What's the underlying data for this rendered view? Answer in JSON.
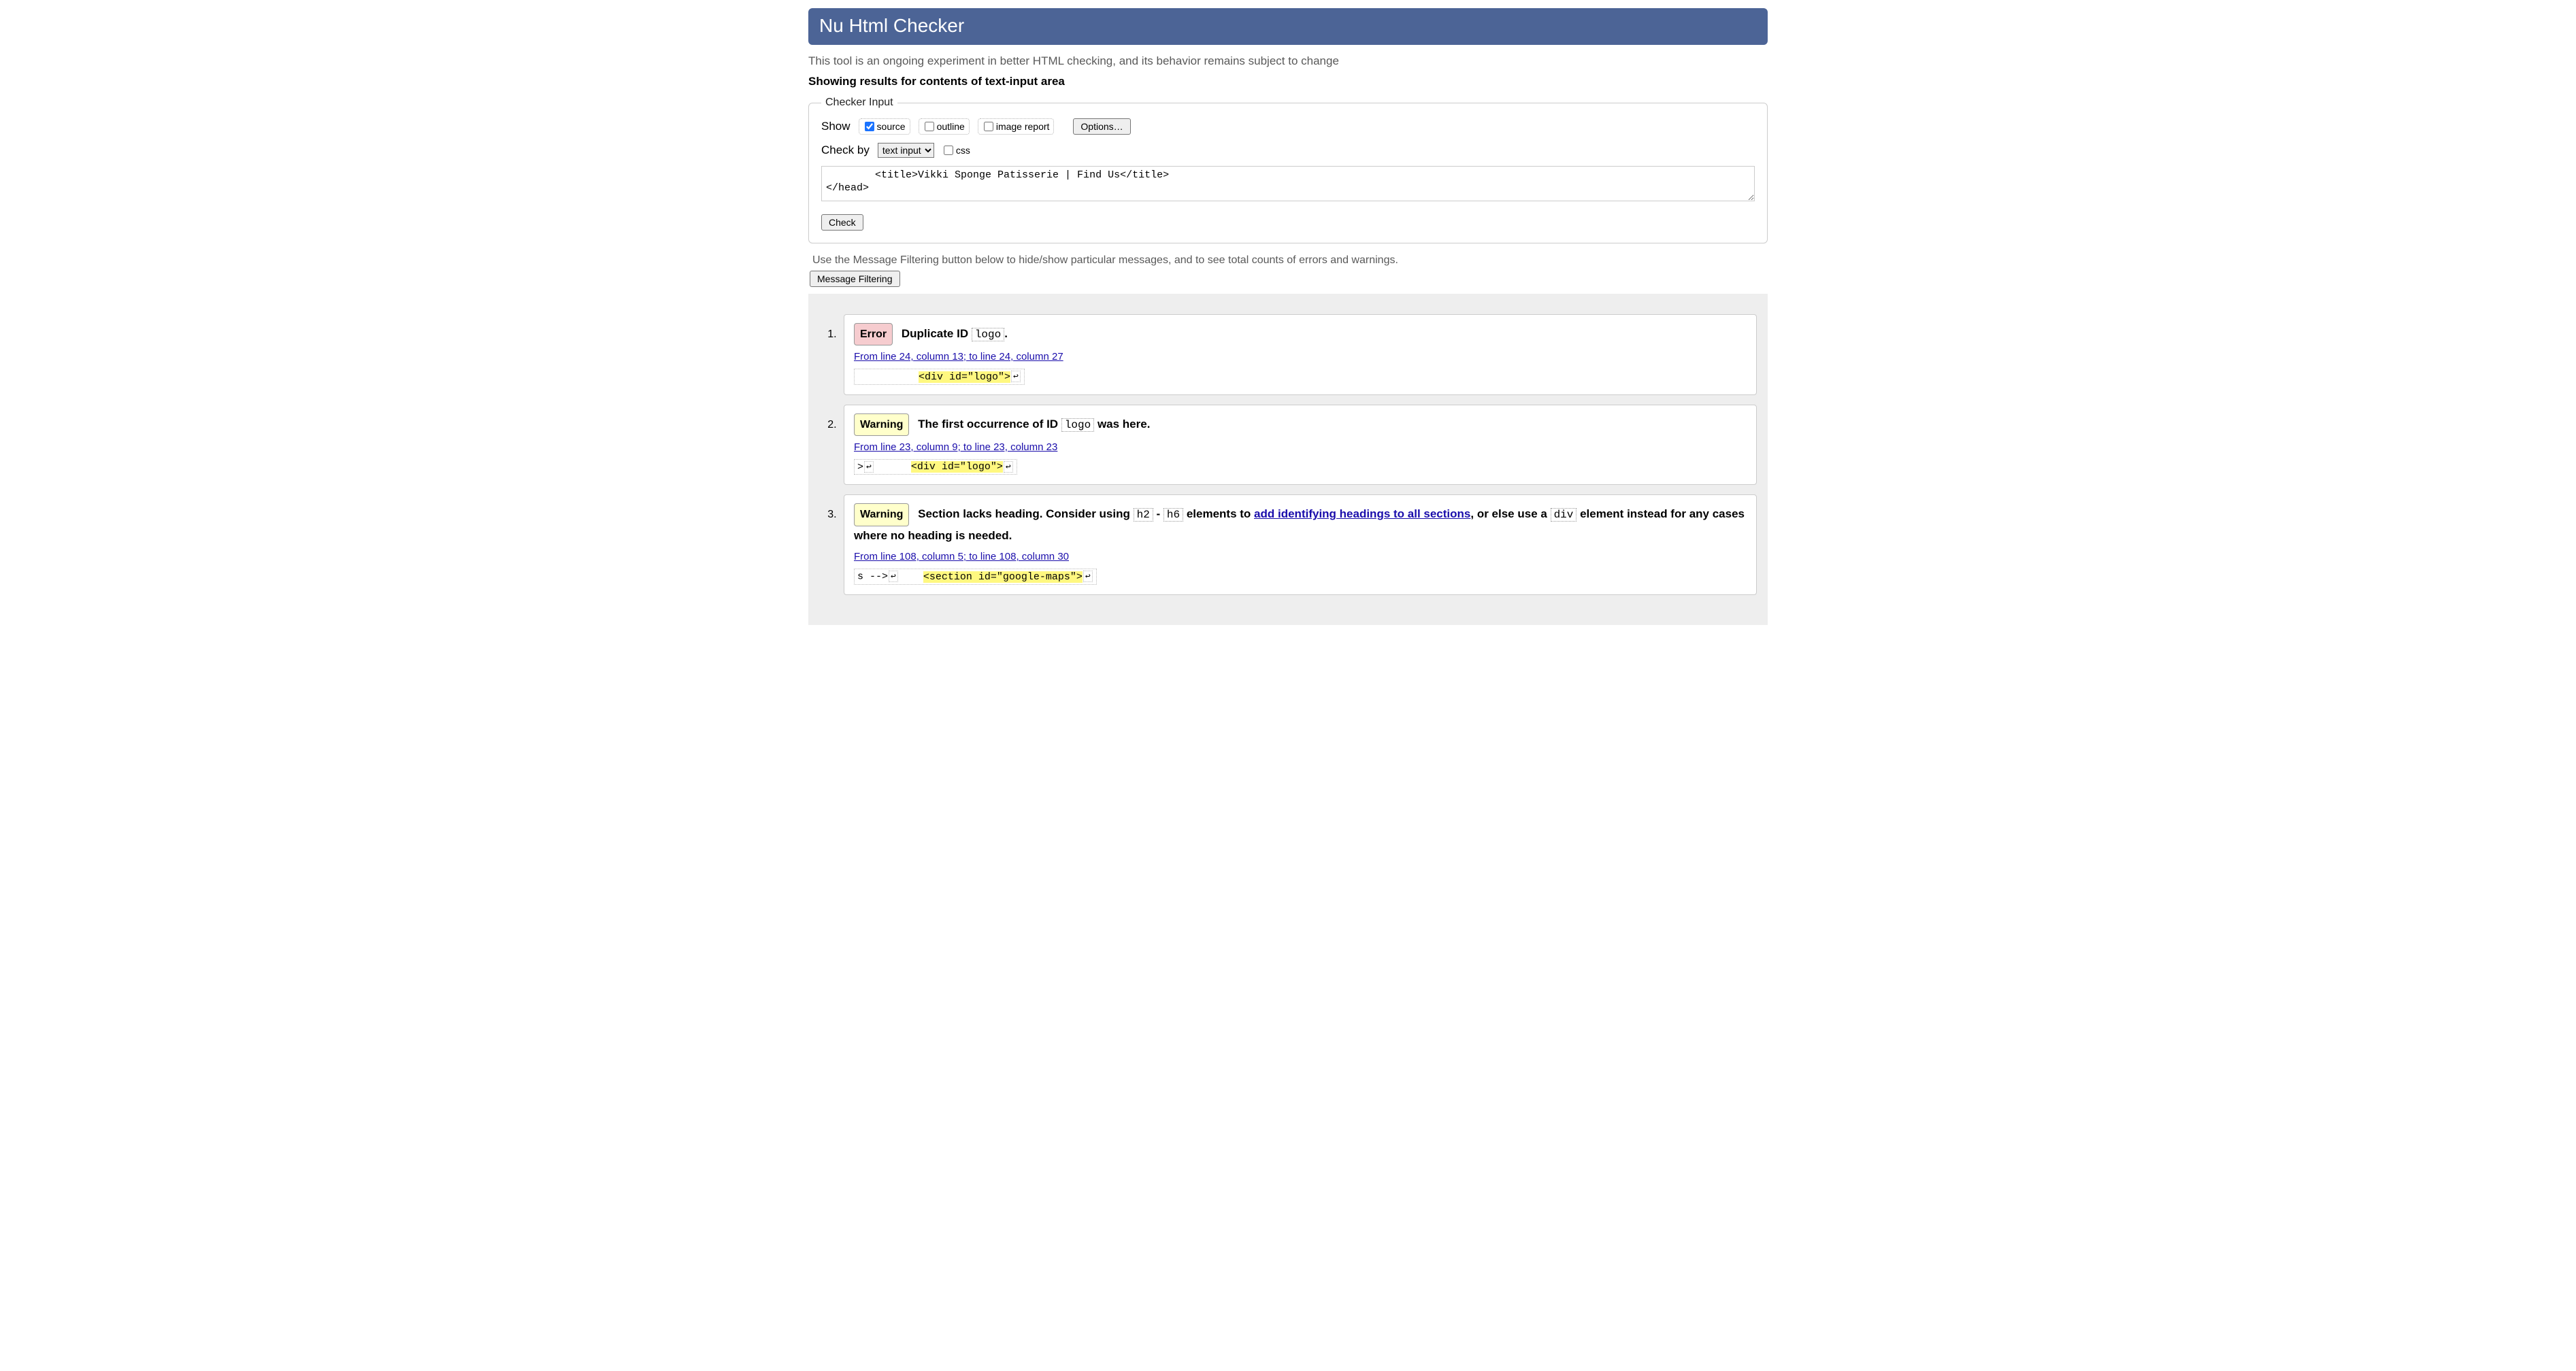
{
  "banner": {
    "title": "Nu Html Checker"
  },
  "intro": "This tool is an ongoing experiment in better HTML checking, and its behavior remains subject to change",
  "subheading": "Showing results for contents of text-input area",
  "checkerInput": {
    "legend": "Checker Input",
    "showLabel": "Show",
    "sourceLabel": "source",
    "sourceChecked": true,
    "outlineLabel": "outline",
    "outlineChecked": false,
    "imageReportLabel": "image report",
    "imageReportChecked": false,
    "optionsBtn": "Options…",
    "checkByLabel": "Check by",
    "checkByOptions": [
      "text input"
    ],
    "checkBySelected": "text input",
    "cssLabel": "css",
    "cssChecked": false,
    "textareaValue": "        <title>Vikki Sponge Patisserie | Find Us</title>\n</head>",
    "checkBtn": "Check"
  },
  "filterNote": "Use the Message Filtering button below to hide/show particular messages, and to see total counts of errors and warnings.",
  "filterBtn": "Message Filtering",
  "messages": [
    {
      "type": "error",
      "badge": "Error",
      "text1": "Duplicate ID ",
      "code1": "logo",
      "text2": ".",
      "location": "From line 24, column 13; to line 24, column 27",
      "prefix": "          ",
      "highlight": "<div id=\"logo\">",
      "suffix": "↩"
    },
    {
      "type": "warning",
      "badge": "Warning",
      "text1": "The first occurrence of ID ",
      "code1": "logo",
      "text2": " was here.",
      "location": "From line 23, column 9; to line 23, column 23",
      "prefix": ">↩      ",
      "highlight": "<div id=\"logo\">",
      "suffix": "↩"
    },
    {
      "type": "warning",
      "badge": "Warning",
      "text1": "Section lacks heading. Consider using ",
      "code1": "h2",
      "textDash": "-",
      "code2": "h6",
      "text2": " elements to ",
      "linkText": "add identifying headings to all sections",
      "text3": ", or else use a ",
      "code3": "div",
      "text4": " element instead for any cases where no heading is needed.",
      "location": "From line 108, column 5; to line 108, column 30",
      "prefix": "s -->↩    ",
      "highlight": "<section id=\"google-maps\">",
      "suffix": "↩"
    }
  ]
}
